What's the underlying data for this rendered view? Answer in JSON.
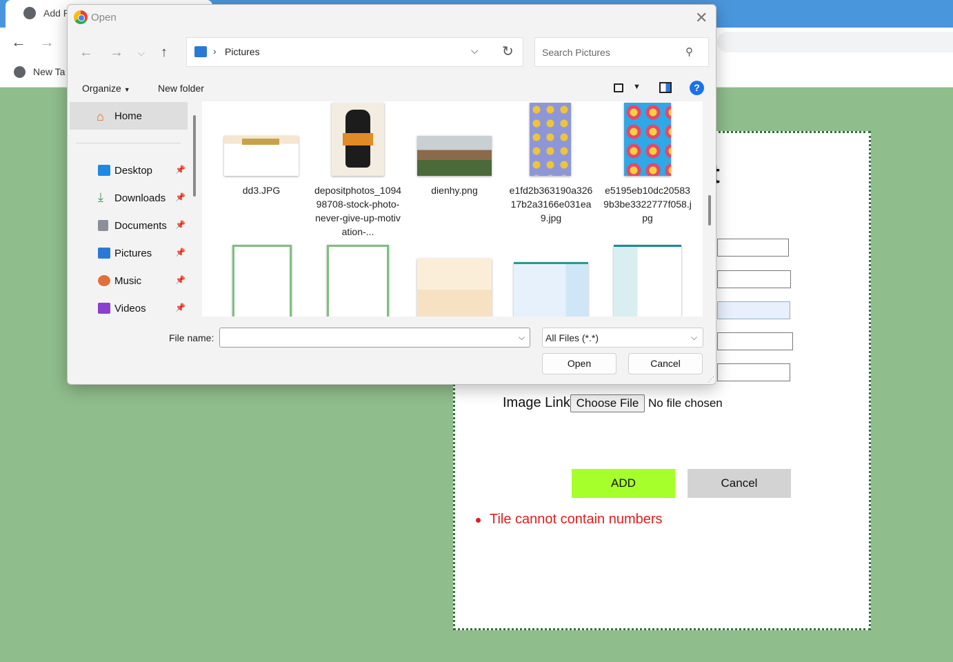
{
  "browser": {
    "tab_title": "Add Pr",
    "bookmark_label": "New Ta"
  },
  "form": {
    "title_fragment": "ct",
    "image_label": "Image Link",
    "choose_file": "Choose File",
    "no_file": "No file chosen",
    "add_label": "ADD",
    "cancel_label": "Cancel",
    "error_message": "Tile cannot contain numbers"
  },
  "dialog": {
    "title": "Open",
    "path_location": "Pictures",
    "search_placeholder": "Search Pictures",
    "organize": "Organize",
    "new_folder": "New folder",
    "help": "?",
    "sidebar": {
      "home": "Home",
      "items": [
        {
          "label": "Desktop",
          "icon": "desktop-icon",
          "color": "#1e88e5"
        },
        {
          "label": "Downloads",
          "icon": "download-icon",
          "color": "#3a9a5a"
        },
        {
          "label": "Documents",
          "icon": "documents-icon",
          "color": "#8a8f99"
        },
        {
          "label": "Pictures",
          "icon": "pictures-icon",
          "color": "#2a79d6"
        },
        {
          "label": "Music",
          "icon": "music-icon",
          "color": "#e0703b"
        },
        {
          "label": "Videos",
          "icon": "videos-icon",
          "color": "#8a3fd1"
        }
      ]
    },
    "files": [
      {
        "name": "dd3.JPG"
      },
      {
        "name": "depositphotos_109498708-stock-photo-never-give-up-motivation-..."
      },
      {
        "name": "dienhy.png"
      },
      {
        "name": "e1fd2b363190a32617b2a3166e031ea9.jpg"
      },
      {
        "name": "e5195eb10dc205839b3be3322777f058.jpg"
      }
    ],
    "file_name_label": "File name:",
    "file_name_value": "",
    "file_type": "All Files (*.*)",
    "open_button": "Open",
    "cancel_button": "Cancel"
  }
}
